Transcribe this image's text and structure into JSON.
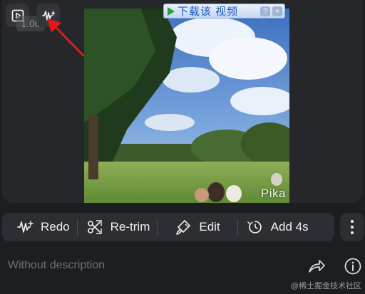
{
  "overlay": {
    "time_ghost": "1.00",
    "banner_text": "下载该 视频",
    "banner_help": "?",
    "banner_close": "×"
  },
  "video": {
    "watermark": "Pika"
  },
  "toolbar": {
    "redo_label": "Redo",
    "retrim_label": "Re-trim",
    "edit_label": "Edit",
    "add_label": "Add 4s"
  },
  "footer": {
    "description_placeholder": "Without description",
    "credit": "@稀土掘金技术社区"
  },
  "colors": {
    "background": "#1d1e21",
    "panel": "#2d2e33",
    "annotation_arrow": "#e0191b",
    "banner_text": "#1e5abf"
  },
  "icons": [
    "play-icon",
    "waveform-icon",
    "redo-icon",
    "retrim-icon",
    "edit-brush-icon",
    "add-time-icon",
    "more-icon",
    "share-icon",
    "info-icon"
  ]
}
